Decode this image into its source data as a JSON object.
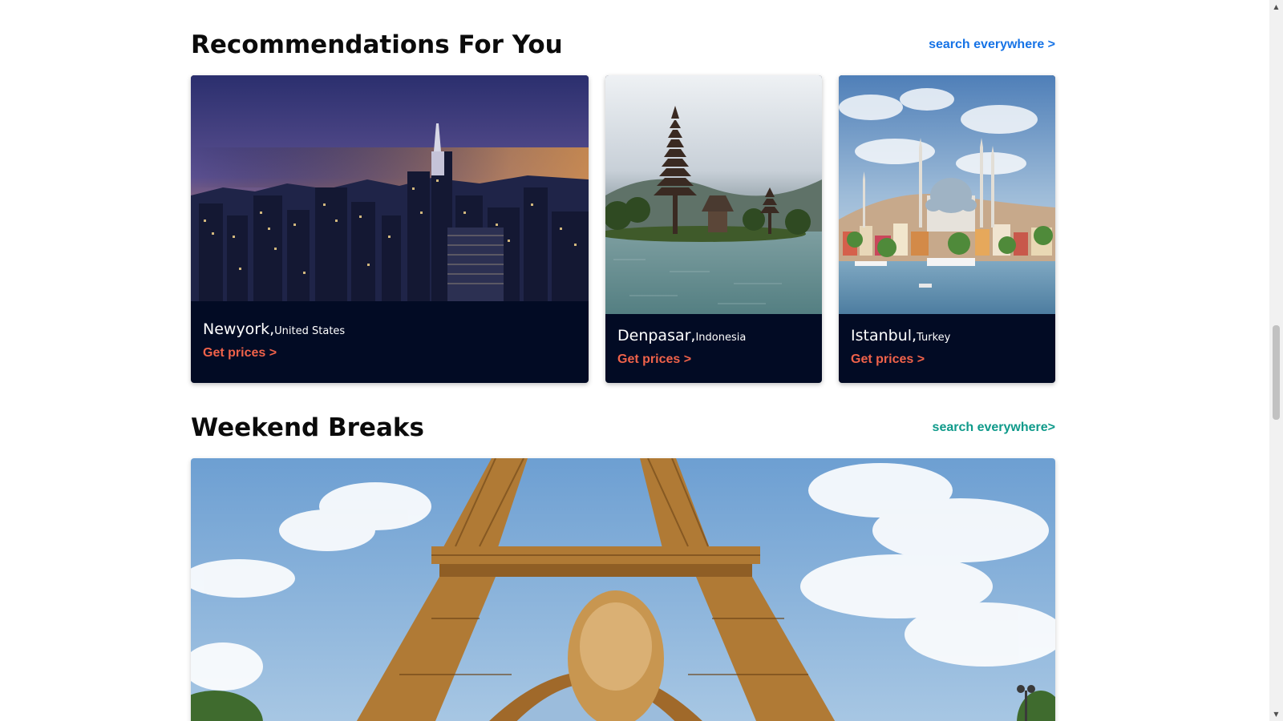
{
  "recommendations": {
    "title": "Recommendations For You",
    "search_link": "search everywhere >",
    "cards": [
      {
        "city": "Newyork,",
        "country": "United States",
        "cta": "Get prices >"
      },
      {
        "city": "Denpasar,",
        "country": "Indonesia",
        "cta": "Get prices >"
      },
      {
        "city": "Istanbul,",
        "country": "Turkey",
        "cta": "Get prices >"
      }
    ]
  },
  "weekend": {
    "title": "Weekend Breaks",
    "search_link": "search everywhere>"
  },
  "colors": {
    "card_background": "#020b24",
    "cta_color": "#f0624a",
    "link_blue": "#1673e6",
    "link_teal": "#0f9a8a"
  },
  "icons": {
    "scroll_up": "scroll-up-arrow-icon",
    "scroll_down": "scroll-down-arrow-icon"
  }
}
